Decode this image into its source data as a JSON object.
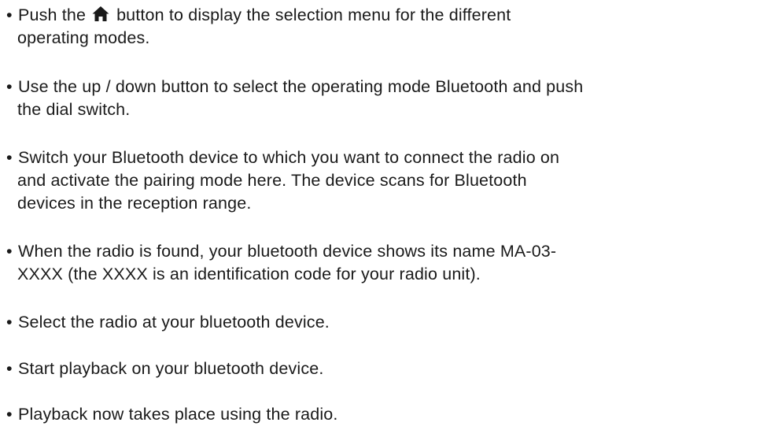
{
  "bullet": "•",
  "icons": {
    "home": "home-icon"
  },
  "steps": [
    {
      "pre": "Push the",
      "post": "button to display the selection menu for the different",
      "line2": "operating modes."
    },
    {
      "line1": "Use the up / down button to select the operating mode Bluetooth and push",
      "line2": "the dial switch."
    },
    {
      "line1": "Switch your Bluetooth device to which you want to connect the radio on",
      "line2": "and activate the pairing mode here. The device scans for Bluetooth",
      "line3": "devices in the reception range."
    },
    {
      "line1": "When the radio is found, your bluetooth device shows its name MA-03-",
      "line2": "XXXX (the XXXX is an identification code for your radio unit)."
    },
    {
      "line1": "Select the radio at your bluetooth device."
    },
    {
      "line1": "Start playback on your bluetooth device."
    },
    {
      "line1": "Playback now takes place using the radio."
    }
  ]
}
